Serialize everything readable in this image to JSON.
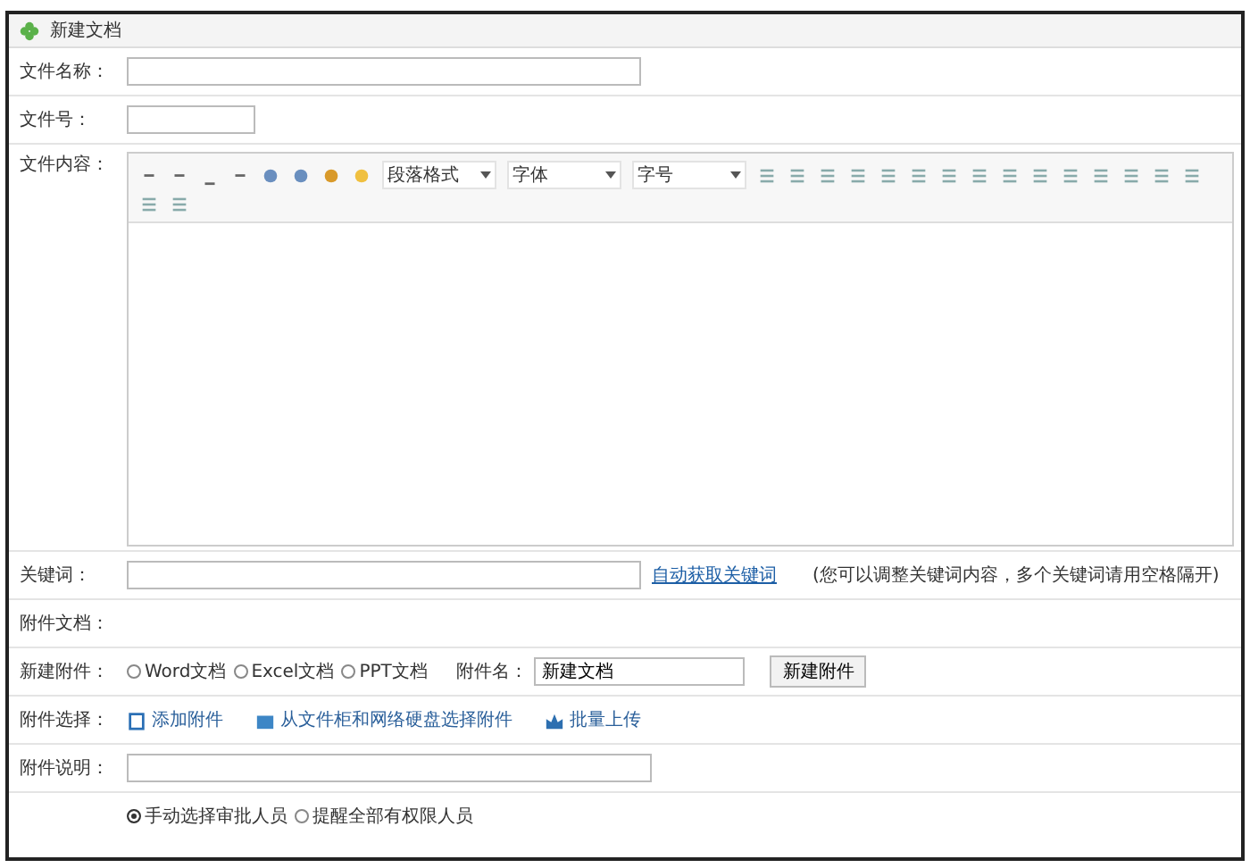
{
  "title": "新建文档",
  "fields": {
    "name_label": "文件名称：",
    "number_label": "文件号：",
    "content_label": "文件内容："
  },
  "editor": {
    "dropdowns": [
      {
        "value": "段落格式"
      },
      {
        "value": "字体"
      },
      {
        "value": "字号"
      }
    ]
  },
  "keywords": {
    "label": "关键词：",
    "link": "自动获取关键词",
    "hint": "(您可以调整关键词内容，多个关键词请用空格隔开)"
  },
  "attachments_label": "附件文档：",
  "new_attachment": {
    "label": "新建附件：",
    "options": [
      {
        "label": "Word文档",
        "selected": false
      },
      {
        "label": "Excel文档",
        "selected": false
      },
      {
        "label": "PPT文档",
        "selected": false
      }
    ],
    "name_label": "附件名：",
    "name_value": "新建文档",
    "button": "新建附件"
  },
  "attachment_select": {
    "label": "附件选择：",
    "actions": [
      {
        "kind": "add",
        "label": "添加附件"
      },
      {
        "kind": "cabinet",
        "label": "从文件柜和网络硬盘选择附件"
      },
      {
        "kind": "batch",
        "label": "批量上传"
      }
    ]
  },
  "attachment_note": {
    "label": "附件说明："
  },
  "notify": [
    {
      "label": "手动选择审批人员",
      "selected": true
    },
    {
      "label": "提醒全部有权限人员",
      "selected": false
    }
  ]
}
